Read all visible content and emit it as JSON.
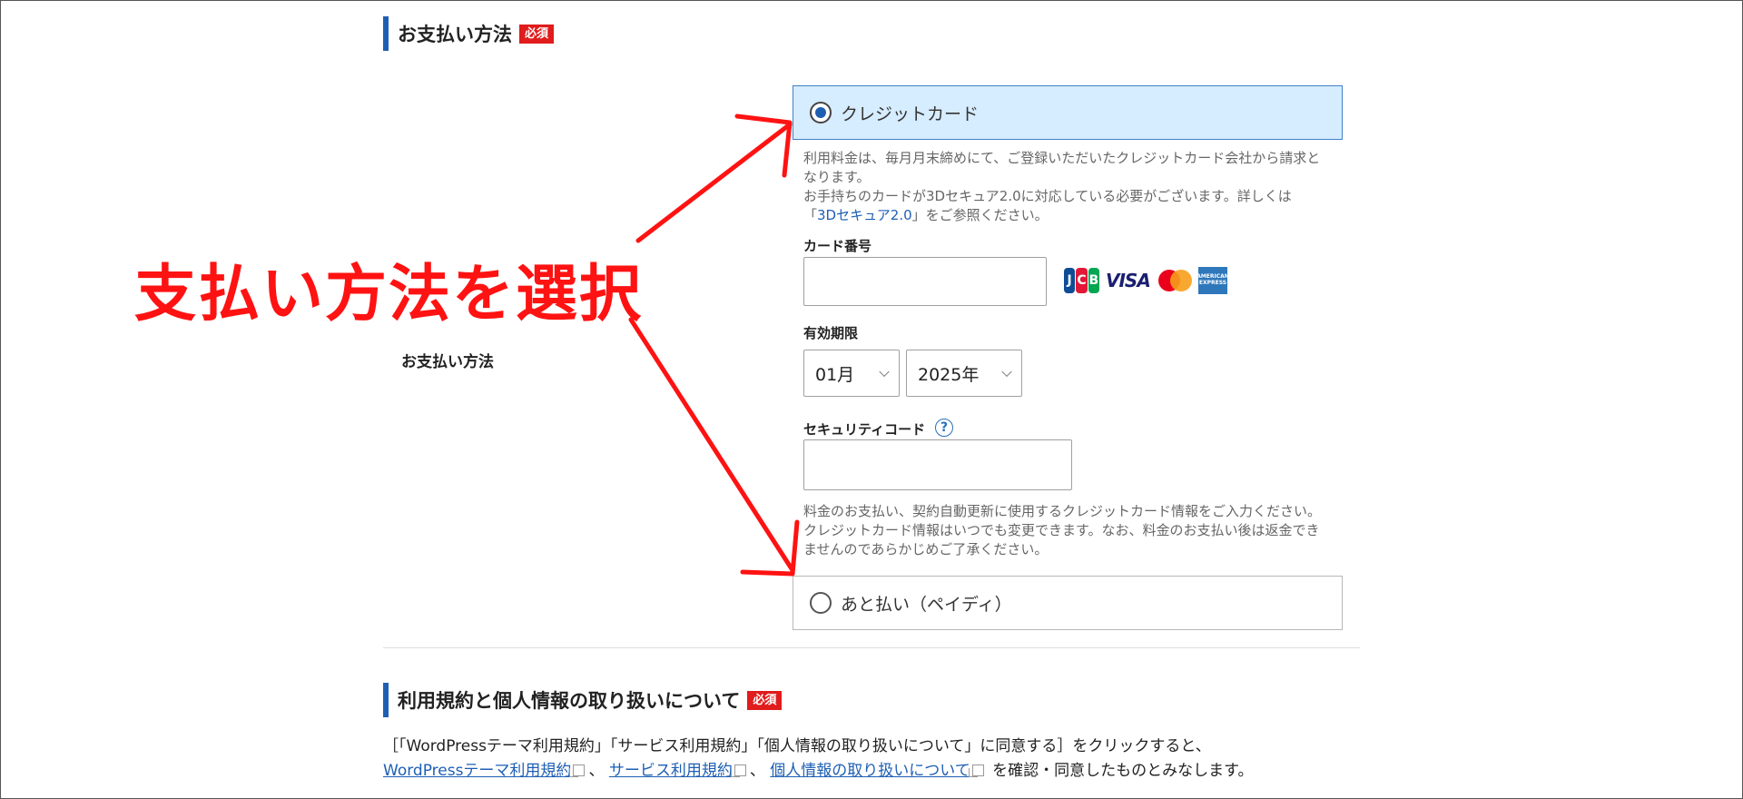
{
  "payment_section": {
    "title": "お支払い方法",
    "required_badge": "必須",
    "row_label": "お支払い方法",
    "options": [
      {
        "label": "クレジットカード",
        "selected": true
      },
      {
        "label": "あと払い（ペイディ）",
        "selected": false
      }
    ],
    "credit_note_line1": "利用料金は、毎月月末締めにて、ご登録いただいたクレジットカード会社から請求と",
    "credit_note_line2": "なります。",
    "credit_note_line3": "お手持ちのカードが3Dセキュア2.0に対応している必要がございます。詳しくは",
    "credit_note_link_open": "「",
    "credit_note_link": "3Dセキュア2.0",
    "credit_note_link_close": "」をご参照ください。",
    "card_number_label": "カード番号",
    "card_number_value": "",
    "card_brands": [
      "JCB",
      "VISA",
      "Mastercard",
      "AMERICAN EXPRESS"
    ],
    "expiry_label": "有効期限",
    "expiry_month": "01月",
    "expiry_year": "2025年",
    "security_code_label": "セキュリティコード",
    "security_help_icon": "?",
    "security_code_value": "",
    "info_note_line1": "料金のお支払い、契約自動更新に使用するクレジットカード情報をご入力ください。",
    "info_note_line2": "クレジットカード情報はいつでも変更できます。なお、料金のお支払い後は返金でき",
    "info_note_line3": "ませんのであらかじめご了承ください。"
  },
  "terms_section": {
    "title": "利用規約と個人情報の取り扱いについて",
    "required_badge": "必須",
    "line1": "［「WordPressテーマ利用規約」「サービス利用規約」「個人情報の取り扱いについて」に同意する］をクリックすると、",
    "link1": "WordPressテーマ利用規約",
    "sep1": "、",
    "link2": "サービス利用規約",
    "sep2": "、",
    "link3": "個人情報の取り扱いについて",
    "line2_tail": "を確認・同意したものとみなします。"
  },
  "annotation": {
    "text": "支払い方法を選択",
    "color": "#ff1212"
  },
  "colors": {
    "accent": "#1e5fb4",
    "required": "#e01c1c",
    "selected_bg": "#d6ecff"
  }
}
